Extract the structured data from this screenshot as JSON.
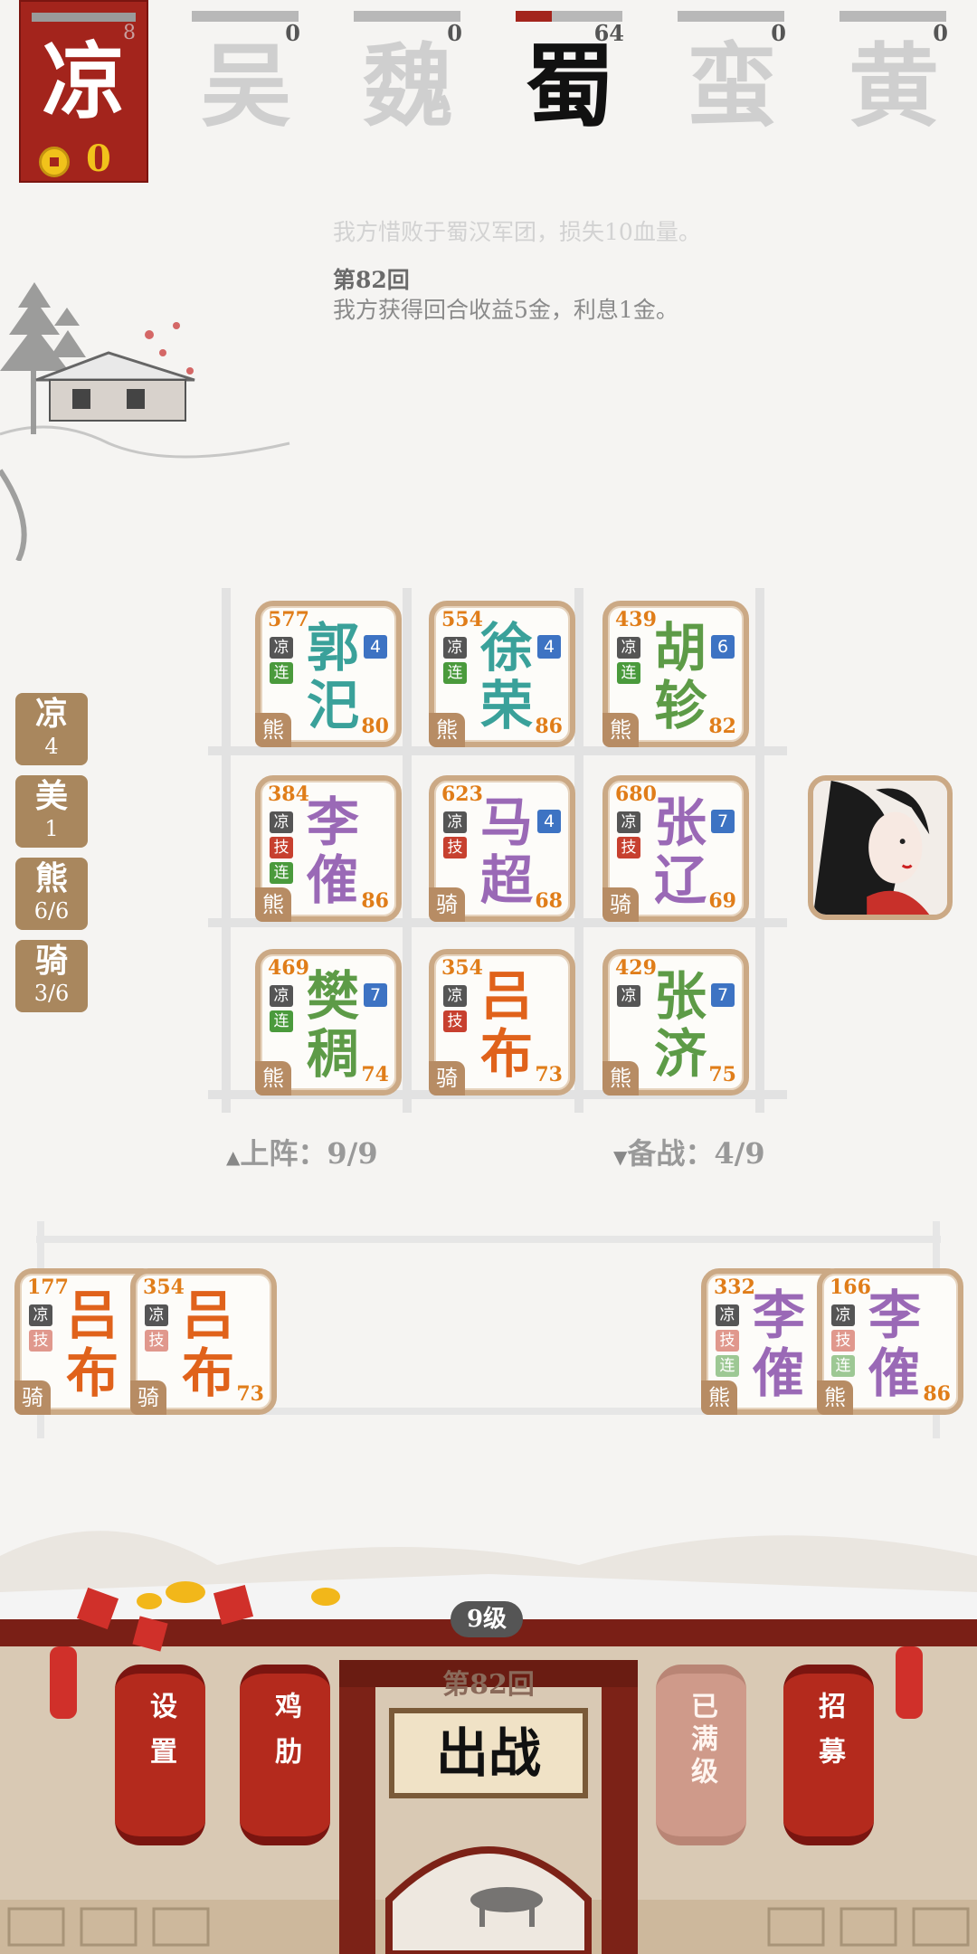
{
  "player": {
    "faction": "凉",
    "level": "8",
    "gold": "0"
  },
  "factions": [
    {
      "name": "吴",
      "score": "0",
      "hp_fraction": 0,
      "active": false
    },
    {
      "name": "魏",
      "score": "0",
      "hp_fraction": 0,
      "active": false
    },
    {
      "name": "蜀",
      "score": "64",
      "hp_fraction": 0.34,
      "active": true
    },
    {
      "name": "蛮",
      "score": "0",
      "hp_fraction": 0,
      "active": false
    },
    {
      "name": "黄",
      "score": "0",
      "hp_fraction": 0,
      "active": false
    }
  ],
  "log": {
    "prev_line": "我方惜败于蜀汉军团，损失10血量。",
    "round_title": "第82回",
    "round_text": "我方获得回合收益5金，利息1金。"
  },
  "synergies": [
    {
      "name": "凉",
      "count": "4"
    },
    {
      "name": "美",
      "count": "1"
    },
    {
      "name": "熊",
      "count": "6/6"
    },
    {
      "name": "骑",
      "count": "3/6"
    }
  ],
  "board": [
    {
      "hp": "577",
      "name": "郭汜",
      "tags": [
        "凉",
        "连"
      ],
      "star": "4",
      "type": "熊",
      "atk": "80",
      "color": "#3aa19a"
    },
    {
      "hp": "554",
      "name": "徐荣",
      "tags": [
        "凉",
        "连"
      ],
      "star": "4",
      "type": "熊",
      "atk": "86",
      "color": "#3aa19a"
    },
    {
      "hp": "439",
      "name": "胡轸",
      "tags": [
        "凉",
        "连"
      ],
      "star": "6",
      "type": "熊",
      "atk": "82",
      "color": "#5d9b47"
    },
    {
      "hp": "384",
      "name": "李傕",
      "tags": [
        "凉",
        "技",
        "连"
      ],
      "star": "",
      "type": "熊",
      "atk": "86",
      "color": "#9a69b6"
    },
    {
      "hp": "623",
      "name": "马超",
      "tags": [
        "凉",
        "技"
      ],
      "star": "4",
      "type": "骑",
      "atk": "68",
      "color": "#9a69b6"
    },
    {
      "hp": "680",
      "name": "张辽",
      "tags": [
        "凉",
        "技"
      ],
      "star": "7",
      "type": "骑",
      "atk": "69",
      "color": "#9a69b6"
    },
    {
      "hp": "469",
      "name": "樊稠",
      "tags": [
        "凉",
        "连"
      ],
      "star": "7",
      "type": "熊",
      "atk": "74",
      "color": "#5d9b47"
    },
    {
      "hp": "354",
      "name": "吕布",
      "tags": [
        "凉",
        "技"
      ],
      "star": "",
      "type": "骑",
      "atk": "73",
      "color": "#e0621b"
    },
    {
      "hp": "429",
      "name": "张济",
      "tags": [
        "凉"
      ],
      "star": "7",
      "type": "熊",
      "atk": "75",
      "color": "#5d9b47"
    }
  ],
  "deploy_label": "上阵：9/9",
  "reserve_label": "备战：4/9",
  "bench": [
    {
      "hp": "177",
      "name": "吕布",
      "tags": [
        "凉",
        "技"
      ],
      "type": "骑",
      "atk": "7",
      "color": "#e0621b",
      "dim": true
    },
    {
      "hp": "354",
      "name": "吕布",
      "tags": [
        "凉",
        "技"
      ],
      "type": "骑",
      "atk": "73",
      "color": "#e0621b",
      "dim": true
    },
    {
      "hp": "332",
      "name": "李傕",
      "tags": [
        "凉",
        "技",
        "连"
      ],
      "type": "熊",
      "atk": "8",
      "color": "#9a69b6",
      "dim": true
    },
    {
      "hp": "166",
      "name": "李傕",
      "tags": [
        "凉",
        "技",
        "连"
      ],
      "type": "熊",
      "atk": "86",
      "color": "#9a69b6",
      "dim": true
    }
  ],
  "footer": {
    "level_badge": "9级",
    "round_label": "第82回",
    "battle_label": "出战",
    "settings_label": "设置",
    "rib_label": "鸡肋",
    "maxed_label": "已满级",
    "recruit_label": "招募"
  },
  "tag_colors": {
    "凉": "#555555",
    "技": "#c7402f",
    "连": "#4a9a3c"
  }
}
